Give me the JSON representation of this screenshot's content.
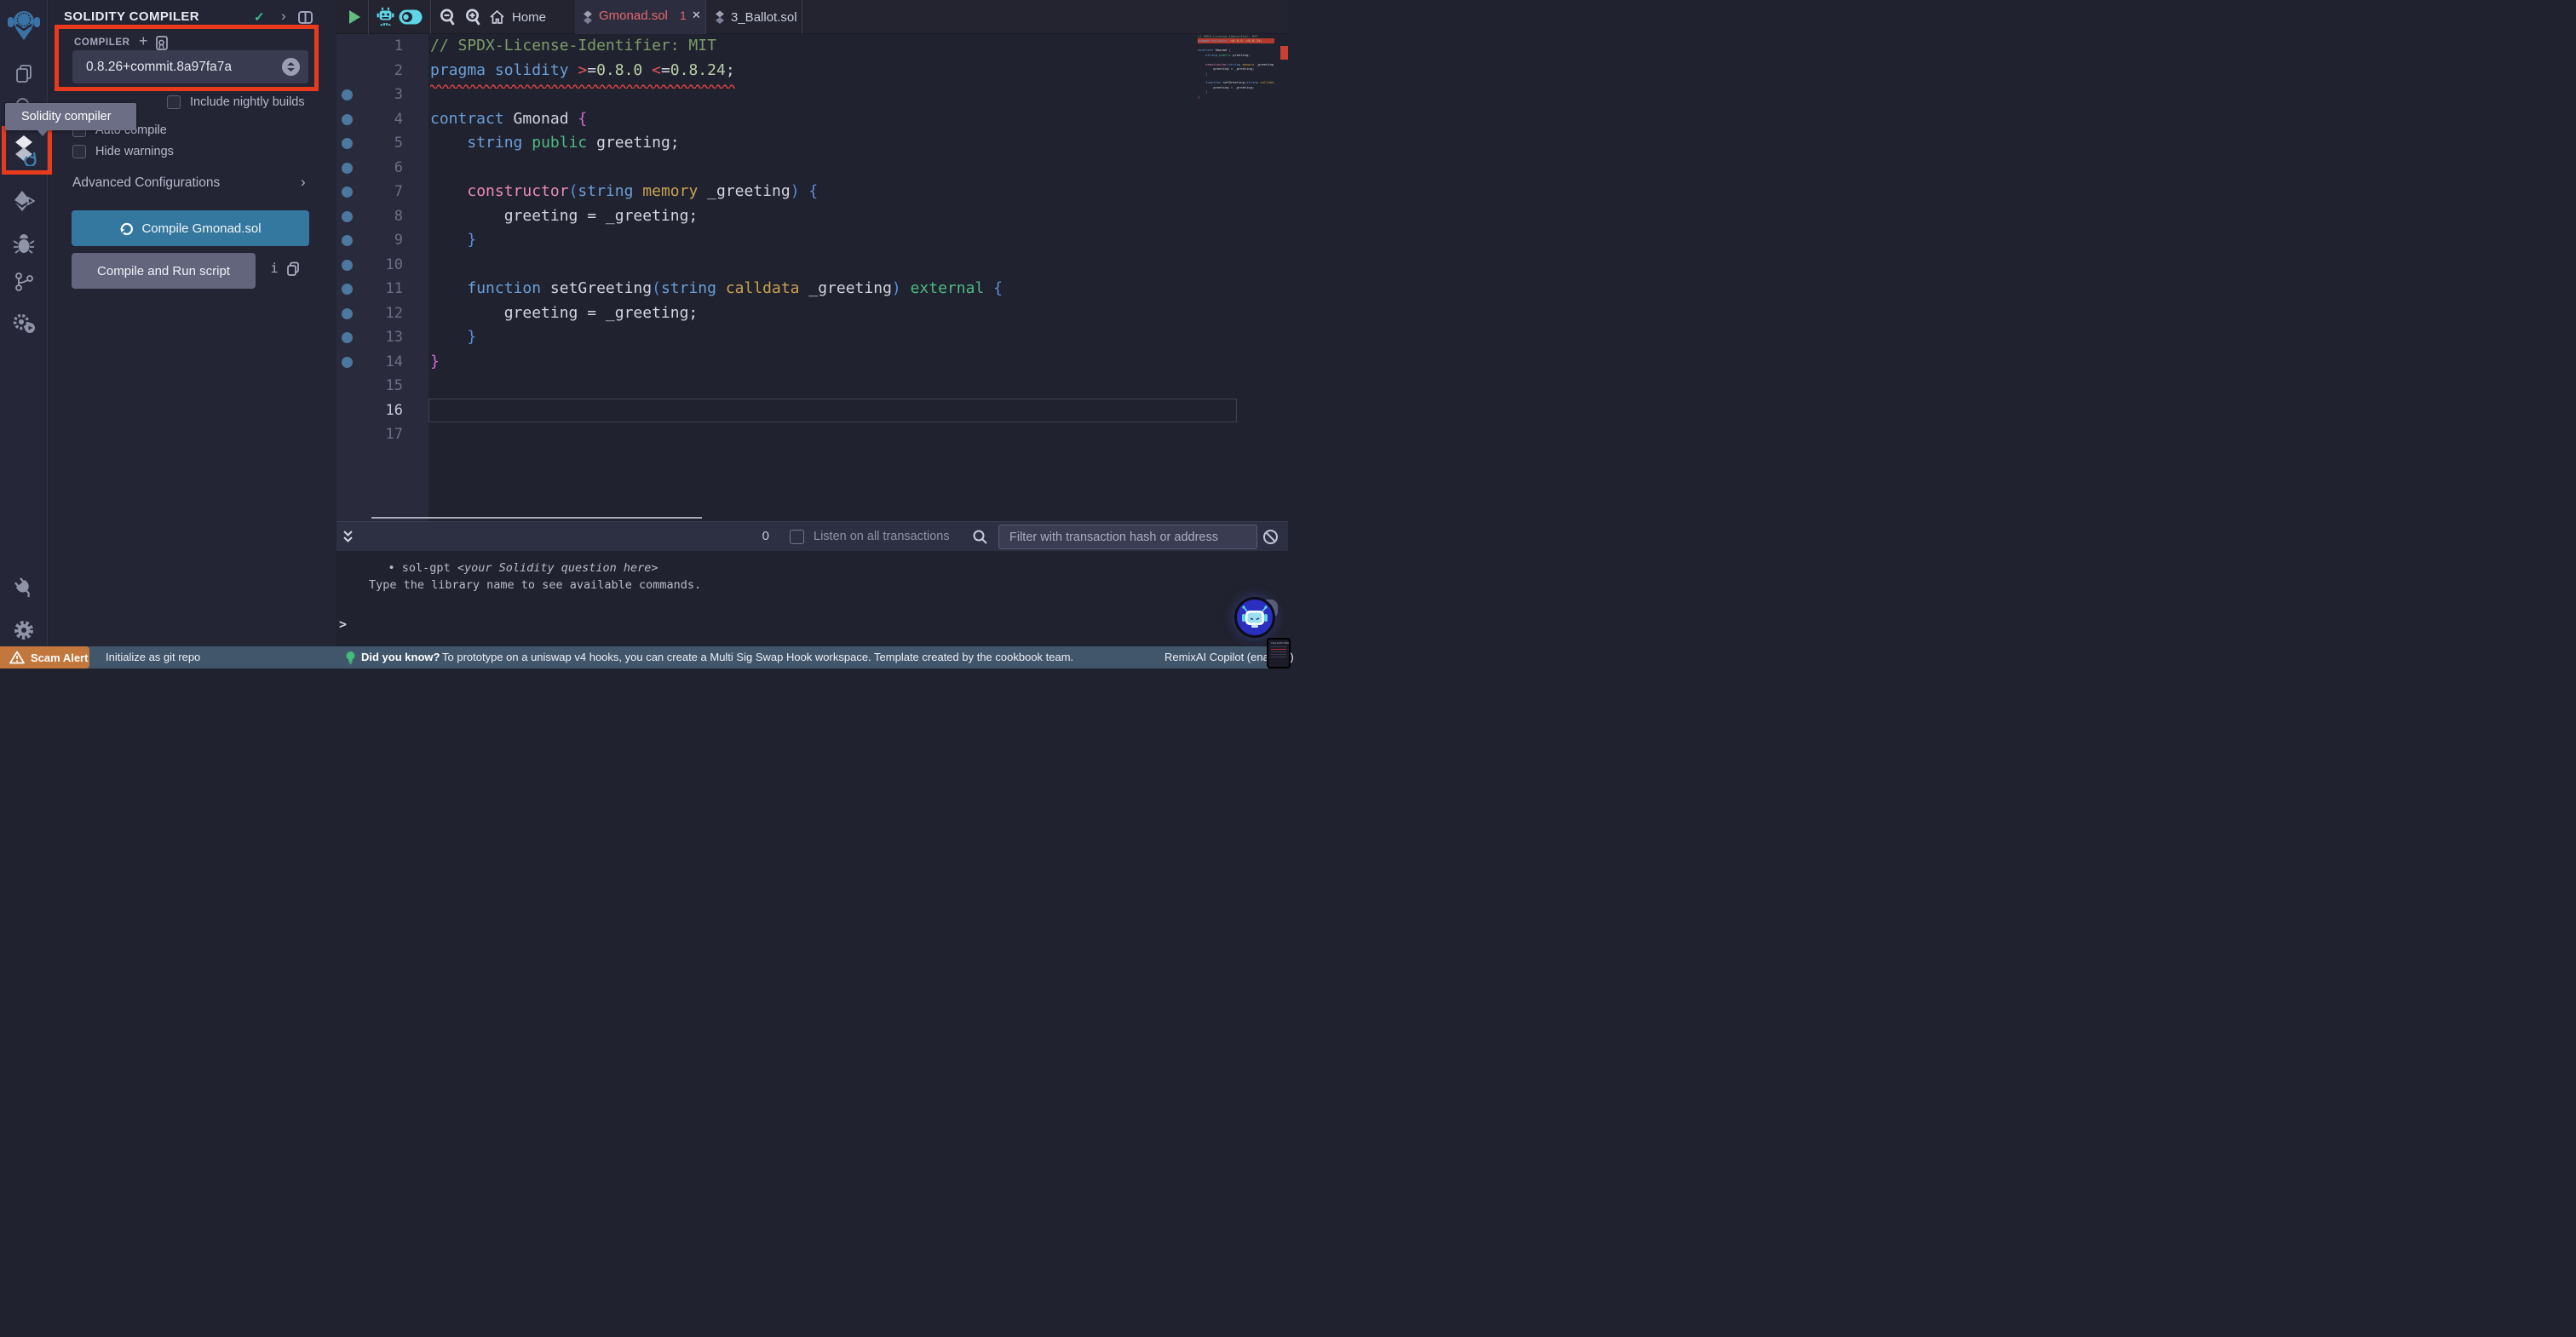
{
  "palette": {
    "accent_blue": "#35789f",
    "annotation_red": "#e83b1e",
    "scam_orange": "#c2773c",
    "statusbar_blue": "#42566b",
    "tab_error_red": "#e4686d",
    "icon_cyan": "#5fd6e7",
    "play_green": "#63bd7e",
    "gutter_dot_blue": "#4a789e",
    "error_marker_red": "#c64033"
  },
  "rail": {
    "icons": [
      "remix-logo",
      "file-explorer-icon",
      "search-icon",
      "solidity-compiler-icon",
      "deploy-run-icon",
      "debugger-icon",
      "git-icon",
      "unit-testing-icon",
      "plugin-manager-icon",
      "settings-gear-icon"
    ]
  },
  "tooltip": {
    "text": "Solidity compiler"
  },
  "panel": {
    "title": "SOLIDITY COMPILER",
    "check_icon": "✓",
    "chevron_icon": "›",
    "compiler_label": "COMPILER",
    "plus_icon": "+",
    "version_selected": "0.8.26+commit.8a97fa7a",
    "checkboxes": [
      {
        "label": "Include nightly builds",
        "checked": false
      },
      {
        "label": "Auto compile",
        "checked": false
      },
      {
        "label": "Hide warnings",
        "checked": false
      }
    ],
    "advanced_label": "Advanced Configurations",
    "advanced_chevron": "›",
    "compile_button": "Compile Gmonad.sol",
    "run_button": "Compile and Run script",
    "info_icon": "i"
  },
  "editor": {
    "home_tab": "Home",
    "tabs": [
      {
        "label": "Gmonad.sol",
        "badge": "1",
        "close": "✕",
        "state": "error-active"
      },
      {
        "label": "3_Ballot.sol",
        "state": "inactive"
      }
    ],
    "current_line": 16,
    "total_lines": 17,
    "lines": [
      {
        "n": 1,
        "dot": false,
        "tokens": [
          [
            "// SPDX-License-Identifier: MIT",
            "c"
          ]
        ]
      },
      {
        "n": 2,
        "dot": false,
        "error": true,
        "tokens": [
          [
            "pragma solidity ",
            "k"
          ],
          [
            ">",
            "o"
          ],
          [
            "=",
            "p"
          ],
          [
            "0.8.0",
            "n"
          ],
          [
            " ",
            "p"
          ],
          [
            "<",
            "o"
          ],
          [
            "=",
            "p"
          ],
          [
            "0.8.24",
            "n"
          ],
          [
            ";",
            "p"
          ]
        ]
      },
      {
        "n": 3,
        "dot": true,
        "tokens": []
      },
      {
        "n": 4,
        "dot": true,
        "tokens": [
          [
            "contract",
            "k"
          ],
          [
            " Gmonad ",
            "p"
          ],
          [
            "{",
            "m"
          ]
        ]
      },
      {
        "n": 5,
        "dot": true,
        "tokens": [
          [
            "    ",
            "p"
          ],
          [
            "string",
            "k"
          ],
          [
            " ",
            "p"
          ],
          [
            "public",
            "e"
          ],
          [
            " greeting;",
            "p"
          ]
        ]
      },
      {
        "n": 6,
        "dot": true,
        "tokens": []
      },
      {
        "n": 7,
        "dot": true,
        "tokens": [
          [
            "    ",
            "p"
          ],
          [
            "constructor",
            "pk"
          ],
          [
            "(",
            "b"
          ],
          [
            "string",
            "k"
          ],
          [
            " ",
            "p"
          ],
          [
            "memory",
            "g"
          ],
          [
            " _greeting",
            "p"
          ],
          [
            ")",
            "b"
          ],
          [
            " ",
            "p"
          ],
          [
            "{",
            "b"
          ]
        ]
      },
      {
        "n": 8,
        "dot": true,
        "tokens": [
          [
            "        greeting = _greeting;",
            "p"
          ]
        ]
      },
      {
        "n": 9,
        "dot": true,
        "tokens": [
          [
            "    ",
            "p"
          ],
          [
            "}",
            "b"
          ]
        ]
      },
      {
        "n": 10,
        "dot": true,
        "tokens": []
      },
      {
        "n": 11,
        "dot": true,
        "tokens": [
          [
            "    ",
            "p"
          ],
          [
            "function",
            "k"
          ],
          [
            " setGreeting",
            "p"
          ],
          [
            "(",
            "b"
          ],
          [
            "string",
            "k"
          ],
          [
            " ",
            "p"
          ],
          [
            "calldata",
            "g"
          ],
          [
            " _greeting",
            "p"
          ],
          [
            ")",
            "b"
          ],
          [
            " ",
            "p"
          ],
          [
            "external",
            "e"
          ],
          [
            " ",
            "p"
          ],
          [
            "{",
            "b"
          ]
        ]
      },
      {
        "n": 12,
        "dot": true,
        "tokens": [
          [
            "        greeting = _greeting;",
            "p"
          ]
        ]
      },
      {
        "n": 13,
        "dot": true,
        "tokens": [
          [
            "    ",
            "p"
          ],
          [
            "}",
            "b"
          ]
        ]
      },
      {
        "n": 14,
        "dot": true,
        "tokens": [
          [
            "}",
            "m"
          ]
        ]
      },
      {
        "n": 15,
        "dot": false,
        "tokens": []
      },
      {
        "n": 16,
        "dot": false,
        "tokens": []
      },
      {
        "n": 17,
        "dot": false,
        "tokens": []
      }
    ]
  },
  "terminal": {
    "count": "0",
    "listen_label": "Listen on all transactions",
    "filter_placeholder": "Filter with transaction hash or address",
    "history_bullet": "•",
    "history_cmd": "sol-gpt ",
    "history_cmd_arg": "<your Solidity question here>",
    "history_hint": "Type the library name to see available commands.",
    "prompt": ">"
  },
  "statusbar": {
    "scam_alert": "Scam Alert",
    "git_init": "Initialize as git repo",
    "tip_label": "Did you know?",
    "tip_text": "To prototype on a uniswap v4 hooks, you can create a Multi Sig Swap Hook workspace. Template created by the cookbook team.",
    "copilot": "RemixAI Copilot (enabled)"
  },
  "pip_overlay": {
    "label": "FILE EXPLORER"
  }
}
